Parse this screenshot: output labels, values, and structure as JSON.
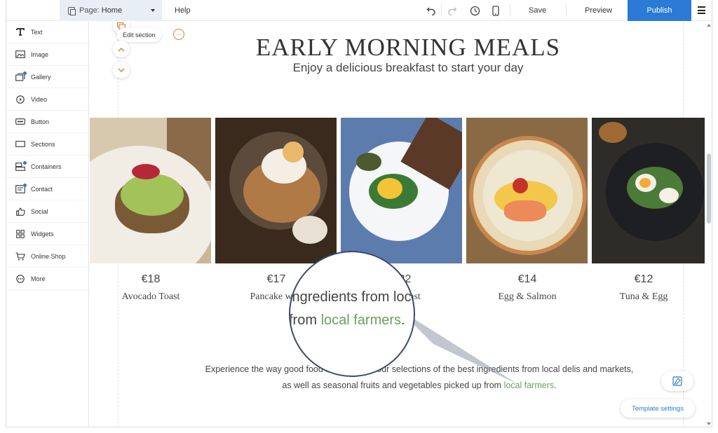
{
  "colors": {
    "accent": "#2b7bd6",
    "edit_orange": "#e07b2e",
    "highlight_green": "#6aa25e",
    "page_select_bg": "#e8eef5"
  },
  "topbar": {
    "page_prefix": "Page:",
    "page_name": "Home",
    "help_label": "Help",
    "save_label": "Save",
    "preview_label": "Preview",
    "publish_label": "Publish",
    "icons": [
      "undo-icon",
      "redo-icon",
      "history-icon",
      "mobile-icon",
      "menu-icon"
    ]
  },
  "sidebar": {
    "items": [
      {
        "label": "Text",
        "icon": "text-icon",
        "badge": false
      },
      {
        "label": "Image",
        "icon": "image-icon",
        "badge": false
      },
      {
        "label": "Gallery",
        "icon": "gallery-icon",
        "badge": true
      },
      {
        "label": "Video",
        "icon": "video-icon",
        "badge": false
      },
      {
        "label": "Button",
        "icon": "button-icon",
        "badge": false
      },
      {
        "label": "Sections",
        "icon": "sections-icon",
        "badge": false
      },
      {
        "label": "Containers",
        "icon": "containers-icon",
        "badge": true
      },
      {
        "label": "Contact",
        "icon": "contact-icon",
        "badge": true
      },
      {
        "label": "Social",
        "icon": "thumbs-up-icon",
        "badge": false
      },
      {
        "label": "Widgets",
        "icon": "widgets-icon",
        "badge": false
      },
      {
        "label": "Online Shop",
        "icon": "cart-icon",
        "badge": false
      },
      {
        "label": "More",
        "icon": "more-icon",
        "badge": false
      }
    ]
  },
  "editor": {
    "edit_section_label": "Edit section"
  },
  "section": {
    "heading": "EARLY MORNING MEALS",
    "subheading": "Enjoy a delicious breakfast to start your day",
    "items": [
      {
        "price": "€18",
        "name": "Avocado Toast"
      },
      {
        "price": "€17",
        "name": "Pancake with"
      },
      {
        "price": "€22",
        "name": "Breakfast"
      },
      {
        "price": "€14",
        "name": "Egg & Salmon"
      },
      {
        "price": "€12",
        "name": "Tuna & Egg"
      }
    ],
    "body_line1": "Experience the way good food is made with our selections of the best ingredients from local delis and markets,",
    "body_line2_prefix": "as well as seasonal fruits and vegetables picked up from",
    "body_line2_link": "local farmers",
    "body_line2_suffix": "."
  },
  "magnifier": {
    "line1": "ingredients from loca",
    "line2_prefix": "from",
    "line2_link": "local farmers",
    "line2_suffix": "."
  },
  "floating": {
    "template_settings_label": "Template settings",
    "design_icon": "design-icon"
  }
}
